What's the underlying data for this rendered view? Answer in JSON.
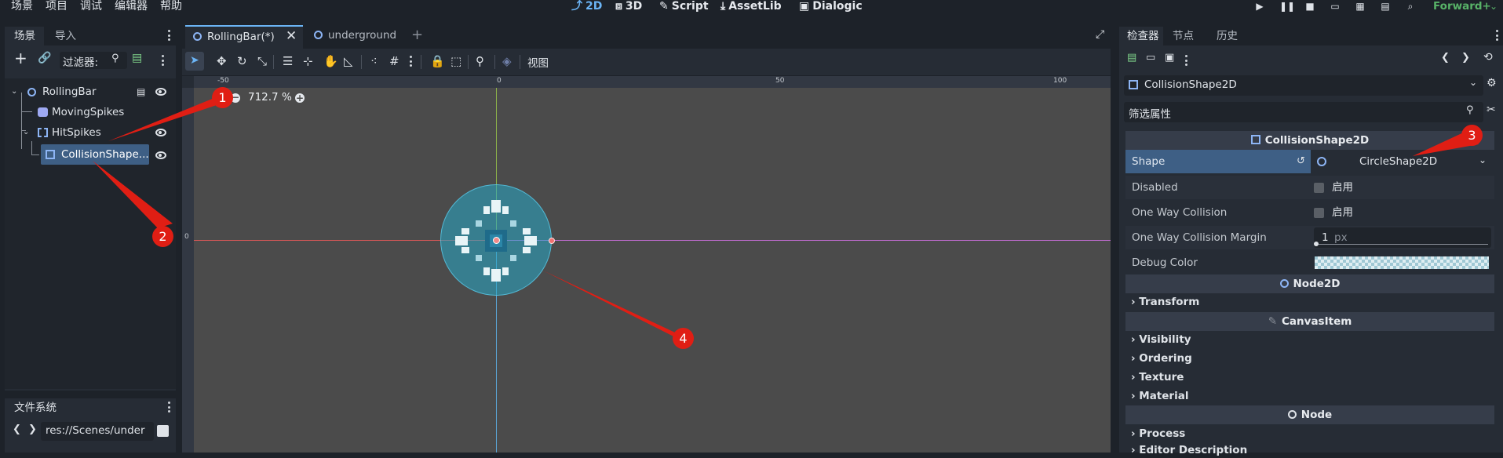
{
  "menubar": {
    "items": [
      "场景",
      "项目",
      "调试",
      "编辑器",
      "帮助"
    ],
    "workspaces": [
      {
        "label": "2D",
        "active": true
      },
      {
        "label": "3D",
        "active": false
      },
      {
        "label": "Script",
        "active": false
      },
      {
        "label": "AssetLib",
        "active": false
      },
      {
        "label": "Dialogic",
        "active": false
      }
    ],
    "renderer": "Forward+"
  },
  "scene_dock": {
    "tabs": [
      "场景",
      "导入"
    ],
    "filter_placeholder": "过滤器:",
    "nodes": [
      {
        "label": "RollingBar",
        "icon": "node2d-icon",
        "selected": false
      },
      {
        "label": "MovingSpikes",
        "icon": "character-icon",
        "selected": false
      },
      {
        "label": "HitSpikes",
        "icon": "area2d-icon",
        "selected": false
      },
      {
        "label": "CollisionShape...",
        "icon": "collision-shape-icon",
        "selected": true
      }
    ]
  },
  "filesystem_dock": {
    "title": "文件系统",
    "path": "res://Scenes/under"
  },
  "editor_tabs": [
    {
      "label": "RollingBar(*)",
      "active": true
    },
    {
      "label": "underground",
      "active": false
    }
  ],
  "toolbar": {
    "view_label": "视图"
  },
  "viewport": {
    "zoom": "712.7 %",
    "ruler_labels": [
      "-50",
      "0",
      "50",
      "100"
    ],
    "ruler_v_label": "0"
  },
  "inspector": {
    "tabs": [
      "检查器",
      "节点",
      "历史"
    ],
    "node_name": "CollisionShape2D",
    "filter_placeholder": "筛选属性",
    "sections": {
      "collision": "CollisionShape2D",
      "node2d": "Node2D",
      "canvas_item": "CanvasItem",
      "node": "Node"
    },
    "properties": {
      "shape": {
        "label": "Shape",
        "value": "CircleShape2D"
      },
      "disabled": {
        "label": "Disabled",
        "value": "启用"
      },
      "one_way": {
        "label": "One Way Collision",
        "value": "启用"
      },
      "margin": {
        "label": "One Way Collision Margin",
        "value": "1",
        "unit": "px"
      },
      "debug_color": {
        "label": "Debug Color"
      }
    },
    "categories": {
      "transform": "Transform",
      "visibility": "Visibility",
      "ordering": "Ordering",
      "texture": "Texture",
      "material": "Material",
      "process": "Process",
      "editor_description": "Editor Description"
    }
  },
  "annotations": [
    "1",
    "2",
    "3",
    "4"
  ],
  "colors": {
    "accent": "#6bb4f5",
    "selection": "#3e5f85",
    "marker": "#e01e14",
    "viewport": "#4b4b4b"
  }
}
